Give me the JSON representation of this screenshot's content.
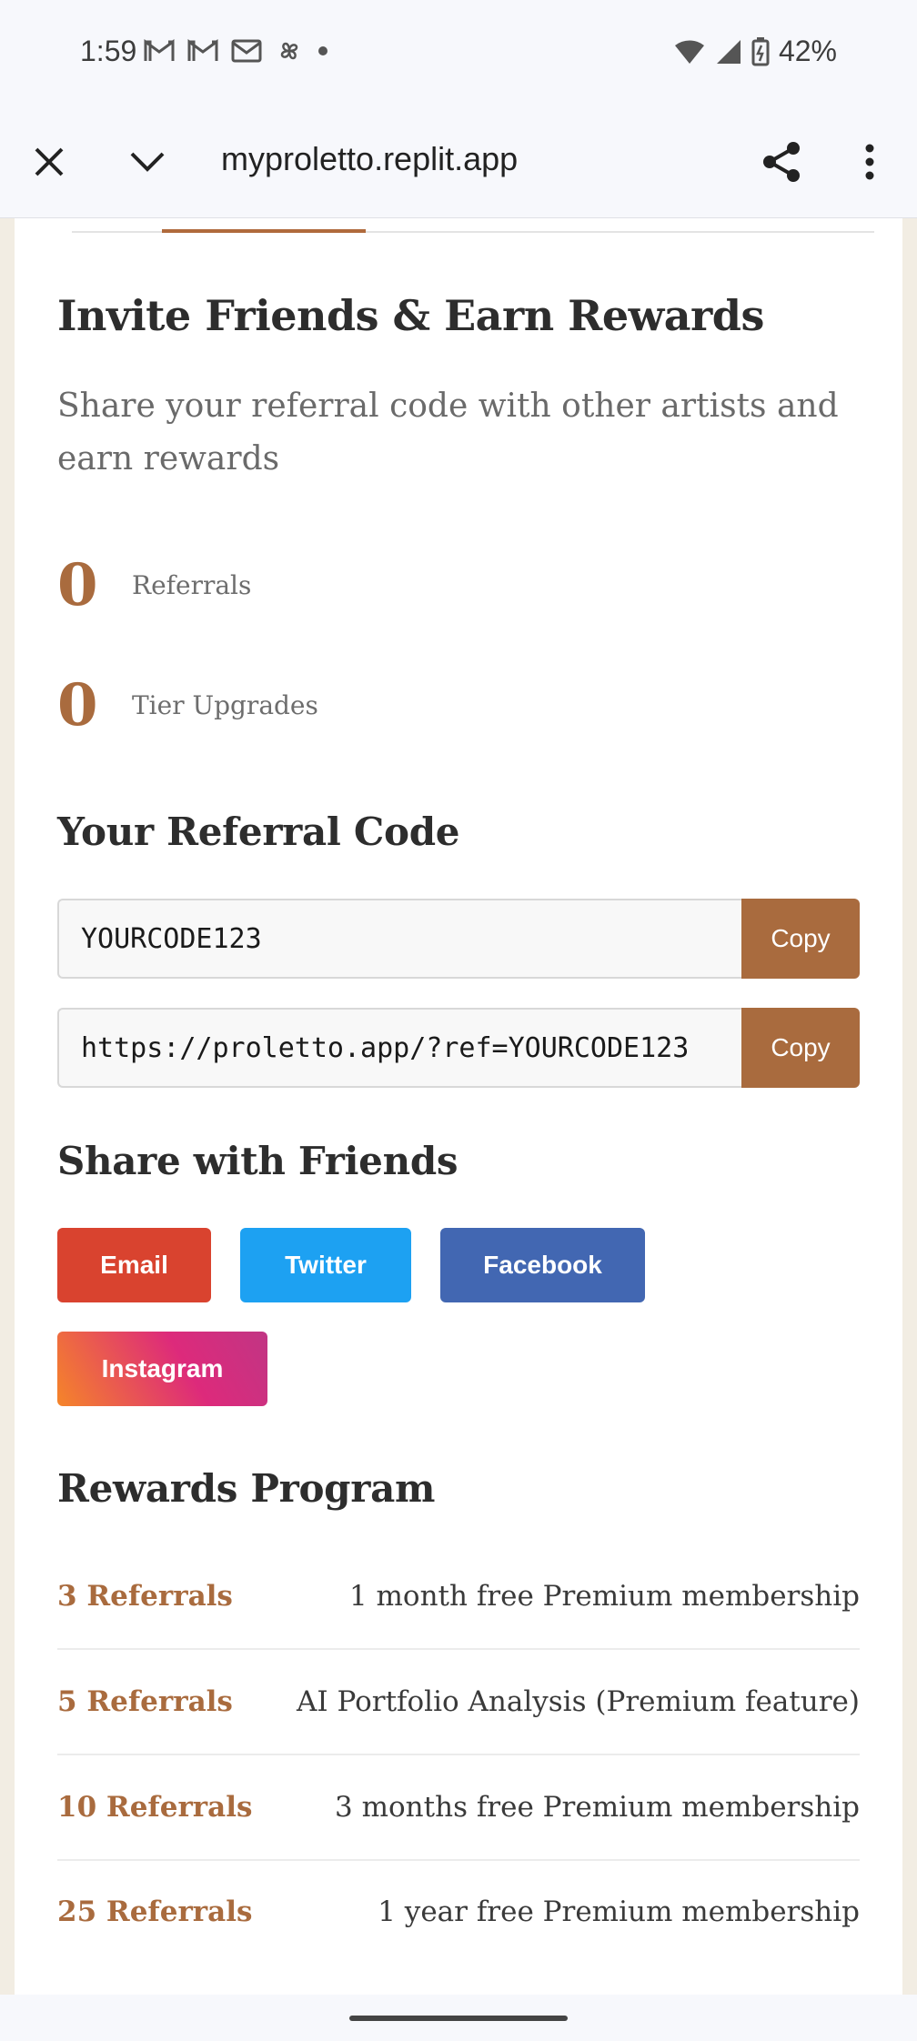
{
  "status_bar": {
    "time": "1:59",
    "battery": "42%",
    "icons": [
      "gmail-icon",
      "gmail-icon",
      "mail-icon",
      "pinwheel-icon",
      "dot-icon",
      "wifi-icon",
      "signal-icon",
      "battery-icon"
    ]
  },
  "browser": {
    "url": "myproletto.replit.app",
    "close_icon": "close-icon",
    "collapse_icon": "chevron-down-icon",
    "share_icon": "share-icon",
    "menu_icon": "more-vert-icon"
  },
  "main": {
    "title": "Invite Friends & Earn Rewards",
    "subtitle": "Share your referral code with other artists and earn rewards",
    "stats": [
      {
        "value": "0",
        "label": "Referrals"
      },
      {
        "value": "0",
        "label": "Tier Upgrades"
      }
    ],
    "referral": {
      "heading": "Your Referral Code",
      "code": "YOURCODE123",
      "link": "https://proletto.app/?ref=YOURCODE123",
      "copy_label": "Copy"
    },
    "share": {
      "heading": "Share with Friends",
      "buttons": [
        "Email",
        "Twitter",
        "Facebook",
        "Instagram"
      ]
    },
    "rewards": {
      "heading": "Rewards Program",
      "items": [
        {
          "count": "3 Referrals",
          "reward": "1 month free Premium membership"
        },
        {
          "count": "5 Referrals",
          "reward": "AI Portfolio Analysis (Premium feature)"
        },
        {
          "count": "10 Referrals",
          "reward": "3 months free Premium membership"
        },
        {
          "count": "25 Referrals",
          "reward": "1 year free Premium membership"
        }
      ]
    }
  },
  "colors": {
    "accent": "#a96b3e",
    "email": "#d9432f",
    "twitter": "#1da1f2",
    "facebook": "#4267b2",
    "instagram_start": "#f58529",
    "instagram_end": "#c13584"
  }
}
